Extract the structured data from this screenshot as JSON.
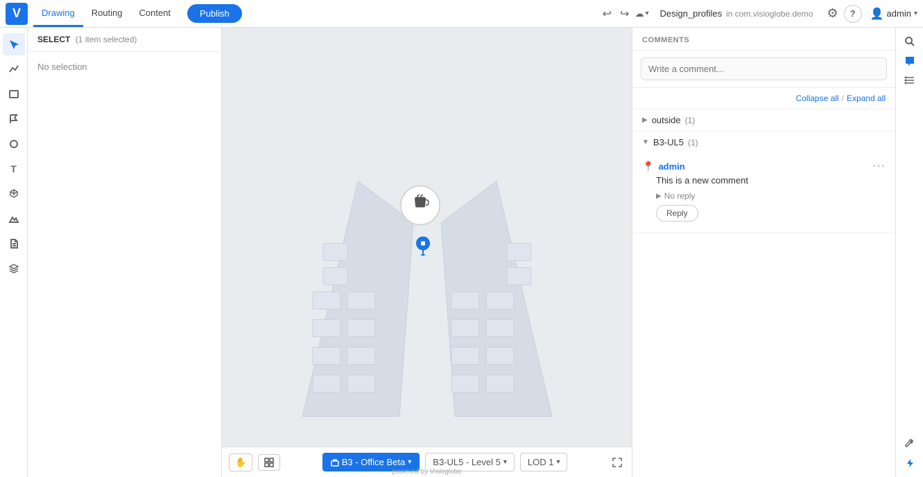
{
  "app": {
    "logo": "V",
    "logo_bg": "#1a73e8"
  },
  "topbar": {
    "tabs": [
      {
        "id": "drawing",
        "label": "Drawing",
        "active": true
      },
      {
        "id": "routing",
        "label": "Routing",
        "active": false
      },
      {
        "id": "content",
        "label": "Content",
        "active": false
      }
    ],
    "publish_label": "Publish",
    "doc_title": "Design_profiles",
    "doc_location": "in com.visioglobe.demo",
    "admin_label": "admin"
  },
  "left_panel": {
    "select_label": "SELECT",
    "select_status": "(1 item selected)",
    "no_selection": "No selection"
  },
  "canvas": {
    "bottom": {
      "floor_label": "B3 - Office Beta",
      "level_label": "B3-UL5 - Level 5",
      "lod_label": "LOD 1",
      "powered_by": "powered by Visioglobe"
    }
  },
  "comments": {
    "header_label": "COMMENTS",
    "input_placeholder": "Write a comment...",
    "collapse_all": "Collapse all",
    "expand_all": "Expand all",
    "separator": "/",
    "groups": [
      {
        "id": "outside",
        "name": "outside",
        "count": "(1)",
        "expanded": false,
        "items": []
      },
      {
        "id": "b3-ul5",
        "name": "B3-UL5",
        "count": "(1)",
        "expanded": true,
        "items": [
          {
            "author": "admin",
            "text": "This is a new comment",
            "no_reply_label": "No reply",
            "reply_label": "Reply"
          }
        ]
      }
    ]
  },
  "icons": {
    "undo": "↩",
    "redo": "↪",
    "cloud": "☁",
    "settings": "⚙",
    "help": "?",
    "user": "👤",
    "chevron_down": "▾",
    "search": "🔍",
    "comment": "💬",
    "list": "≡",
    "wrench": "🔧",
    "bolt": "⚡",
    "hand": "✋",
    "grid": "⊞",
    "pointer": "↖",
    "trend": "↗",
    "rect": "□",
    "flag": "⚑",
    "circle": "○",
    "text": "T",
    "box3d": "▣",
    "mountain": "⛰",
    "doc": "📄",
    "layers": "⊕",
    "more_vert": "⋯",
    "fullscreen": "⛶",
    "location_pin": "📍"
  }
}
